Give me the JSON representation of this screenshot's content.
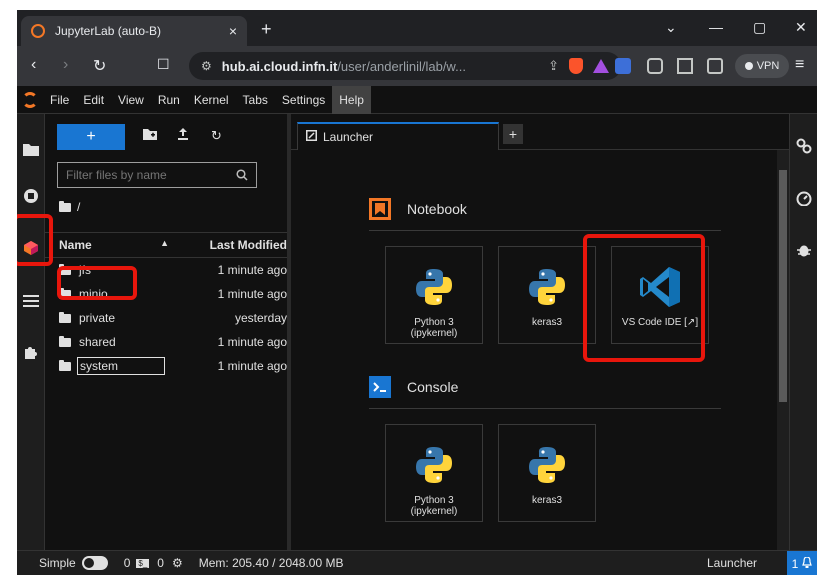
{
  "browser": {
    "tab_title": "JupyterLab (auto-B)",
    "tab_close": "×",
    "new_tab": "+",
    "window_controls": [
      "⌄",
      "—",
      "▢",
      "✕"
    ],
    "nav": {
      "back": "‹",
      "forward": "›",
      "reload": "↻",
      "bookmark": "☐"
    },
    "url_host": "hub.ai.cloud.infn.it",
    "url_path": "/user/anderlinil/lab/w...",
    "vpn_label": "VPN",
    "menu": "≡"
  },
  "menubar": {
    "items": [
      "File",
      "Edit",
      "View",
      "Run",
      "Kernel",
      "Tabs",
      "Settings",
      "Help"
    ],
    "active": "Help"
  },
  "filebrowser": {
    "new_button": "+",
    "filter_placeholder": "Filter files by name",
    "breadcrumb": "/",
    "col_name": "Name",
    "col_modified": "Last Modified",
    "sort_indicator": "▲",
    "rows": [
      {
        "name": "jfs",
        "modified": "1 minute ago"
      },
      {
        "name": "minio",
        "modified": "1 minute ago"
      },
      {
        "name": "private",
        "modified": "yesterday"
      },
      {
        "name": "shared",
        "modified": "1 minute ago"
      },
      {
        "name": "system",
        "modified": "1 minute ago"
      }
    ]
  },
  "main": {
    "tab_label": "Launcher",
    "add_tab": "+",
    "sections": [
      {
        "title": "Notebook",
        "cards": [
          {
            "label": "Python 3\n(ipykernel)",
            "icon": "python-logo"
          },
          {
            "label": "keras3",
            "icon": "python-logo"
          },
          {
            "label": "VS Code IDE [↗]",
            "icon": "vscode-logo"
          }
        ]
      },
      {
        "title": "Console",
        "cards": [
          {
            "label": "Python 3\n(ipykernel)",
            "icon": "python-logo"
          },
          {
            "label": "keras3",
            "icon": "python-logo"
          }
        ]
      }
    ]
  },
  "statusbar": {
    "mode_label": "Simple",
    "terminals_count": "0",
    "kernels_count": "0",
    "memory": "Mem: 205.40 / 2048.00 MB",
    "current": "Launcher",
    "notifications": "1"
  },
  "colors": {
    "accent": "#1976d2",
    "annotation": "#e8160c",
    "jupyter_orange": "#f37726",
    "python_blue": "#3776ab",
    "python_yellow": "#ffd43b",
    "vscode_blue": "#2489ca"
  }
}
